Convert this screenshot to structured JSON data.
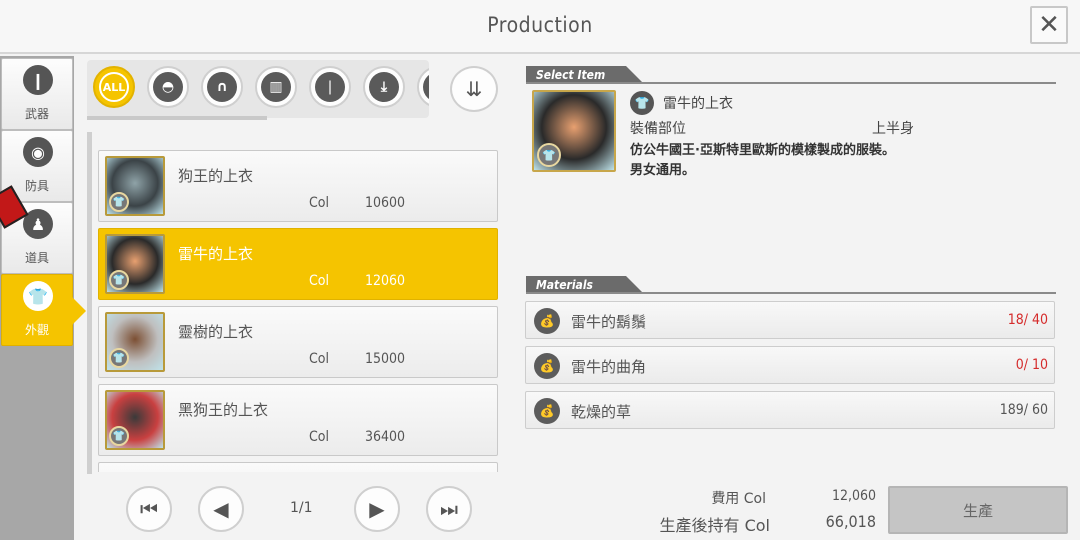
{
  "header": {
    "title": "Production",
    "close_icon": "✕"
  },
  "sidebar": {
    "categories": [
      {
        "label": "武器",
        "icon": "sword-icon",
        "glyph": "❙",
        "active": false
      },
      {
        "label": "防具",
        "icon": "armor-icon",
        "glyph": "◉",
        "active": false
      },
      {
        "label": "道具",
        "icon": "potion-icon",
        "glyph": "♟",
        "active": false
      },
      {
        "label": "外觀",
        "icon": "shirt-icon",
        "glyph": "👕",
        "active": true
      }
    ]
  },
  "filters": [
    {
      "label": "ALL",
      "icon": "all-icon",
      "active": true
    },
    {
      "label": "◓",
      "icon": "jacket-icon"
    },
    {
      "label": "∩",
      "icon": "pants-icon"
    },
    {
      "label": "▥",
      "icon": "shirt-icon"
    },
    {
      "label": "❘",
      "icon": "sword-icon"
    },
    {
      "label": "⤓",
      "icon": "rapier-icon"
    },
    {
      "label": "",
      "icon": "more-icon"
    }
  ],
  "sort_icon": "⇊",
  "items": [
    {
      "name": "狗王的上衣",
      "currency": "Col",
      "price": "10600",
      "selected": false,
      "colors": [
        "#8fa3a8",
        "#3b4347"
      ]
    },
    {
      "name": "雷牛的上衣",
      "currency": "Col",
      "price": "12060",
      "selected": true,
      "colors": [
        "#e8a070",
        "#2a2a2a"
      ]
    },
    {
      "name": "靈樹的上衣",
      "currency": "Col",
      "price": "15000",
      "selected": false,
      "colors": [
        "#7c4f33",
        "#bfbfbf"
      ]
    },
    {
      "name": "黑狗王的上衣",
      "currency": "Col",
      "price": "36400",
      "selected": false,
      "colors": [
        "#3a3a3a",
        "#c94040"
      ]
    }
  ],
  "pager": {
    "first": "⏮",
    "prev": "◀",
    "indicator": "1/1",
    "next": "▶",
    "last": "⏭"
  },
  "detail": {
    "section_label": "Select Item",
    "name": "雷牛的上衣",
    "slot_label": "裝備部位",
    "slot_value": "上半身",
    "description": "仿公牛國王·亞斯特里歐斯的模樣製成的服裝。",
    "note": "男女通用。"
  },
  "materials": {
    "section_label": "Materials",
    "items": [
      {
        "name": "雷牛的鬍鬚",
        "count": "18/ 40",
        "short": true
      },
      {
        "name": "雷牛的曲角",
        "count": "0/ 10",
        "short": true
      },
      {
        "name": "乾燥的草",
        "count": "189/ 60",
        "short": false
      }
    ]
  },
  "cost": {
    "fee_label": "費用 Col",
    "fee_value": "12,060",
    "after_label": "生產後持有 Col",
    "after_value": "66,018"
  },
  "produce_label": "生產",
  "colors": {
    "accent": "#f5c400",
    "short": "#d52b2b"
  }
}
